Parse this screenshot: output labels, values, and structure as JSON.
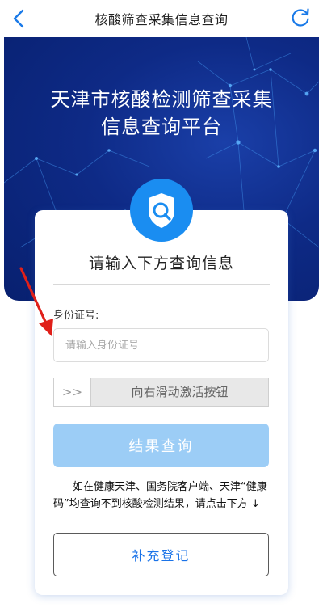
{
  "nav": {
    "title": "核酸筛查采集信息查询",
    "back_icon": "chevron-left-icon",
    "refresh_icon": "refresh-icon"
  },
  "banner": {
    "title_line1": "天津市核酸检测筛查采集",
    "title_line2": "信息查询平台",
    "badge_icon": "shield-search-icon"
  },
  "form": {
    "heading": "请输入下方查询信息",
    "id_label": "身份证号:",
    "id_value": "",
    "id_placeholder": "请输入身份证号",
    "slider_handle": ">>",
    "slider_text": "向右滑动激活按钮",
    "query_button": "结果查询",
    "notice": "如在健康天津、国务院客户端、天津“健康码”均查询不到核酸检测结果，请点击下方 ↓",
    "supplement_button": "补充登记"
  },
  "colors": {
    "banner_dark": "#08206f",
    "banner_mid": "#1a3fa8",
    "accent_blue": "#1a8df1",
    "query_button_disabled": "#9ccdf6",
    "link_blue": "#1a73e8",
    "annotation_arrow": "#e0201a"
  }
}
